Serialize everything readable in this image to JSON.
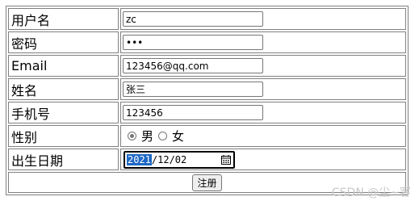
{
  "form": {
    "rows": [
      {
        "label": "用户名",
        "value": "zc"
      },
      {
        "label": "密码",
        "value": "•••"
      },
      {
        "label": "Email",
        "value": "123456@qq.com"
      },
      {
        "label": "姓名",
        "value": "张三"
      },
      {
        "label": "手机号",
        "value": "123456"
      }
    ],
    "gender": {
      "label": "性别",
      "options": [
        "男",
        "女"
      ],
      "selected": "男"
    },
    "birthdate": {
      "label": "出生日期",
      "year": "2021",
      "rest": "/12/02",
      "icon": "calendar-icon"
    },
    "submit_label": "注册"
  },
  "watermark": "CSDN @尘~客"
}
